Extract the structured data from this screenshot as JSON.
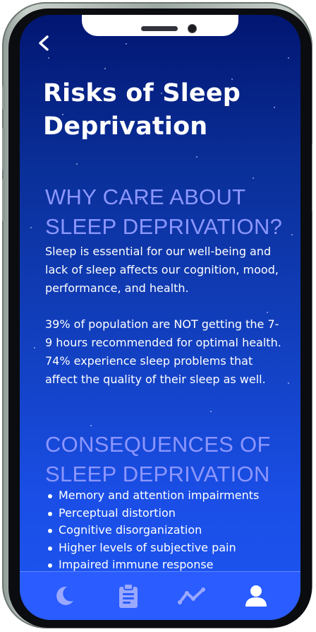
{
  "header": {
    "back_icon": "chevron-left-icon"
  },
  "page": {
    "title": "Risks of Sleep Deprivation"
  },
  "sections": [
    {
      "heading": "WHY CARE ABOUT SLEEP DEPRIVATION?",
      "paragraphs": [
        "Sleep is essential for our well-being and lack of sleep affects our cognition, mood, performance, and health.",
        "39% of population are NOT getting the 7-9 hours recommended for optimal health. 74% experience sleep problems that affect the quality of their sleep as well."
      ]
    },
    {
      "heading": "CONSEQUENCES OF SLEEP DEPRIVATION",
      "bullets": [
        "Memory and attention impairments",
        "Perceptual distortion",
        "Cognitive disorganization",
        "Higher levels of subjective pain",
        "Impaired immune response"
      ]
    }
  ],
  "tabbar": {
    "tabs": [
      {
        "icon": "moon-icon",
        "active": false
      },
      {
        "icon": "clipboard-icon",
        "active": false
      },
      {
        "icon": "trend-line-icon",
        "active": false
      },
      {
        "icon": "user-icon",
        "active": true
      }
    ]
  },
  "colors": {
    "background_top": "#021672",
    "background_bottom": "#1e55f2",
    "heading_accent": "#8c96ff",
    "tab_inactive": "#9aa8ff",
    "tab_active": "#ffffff"
  }
}
